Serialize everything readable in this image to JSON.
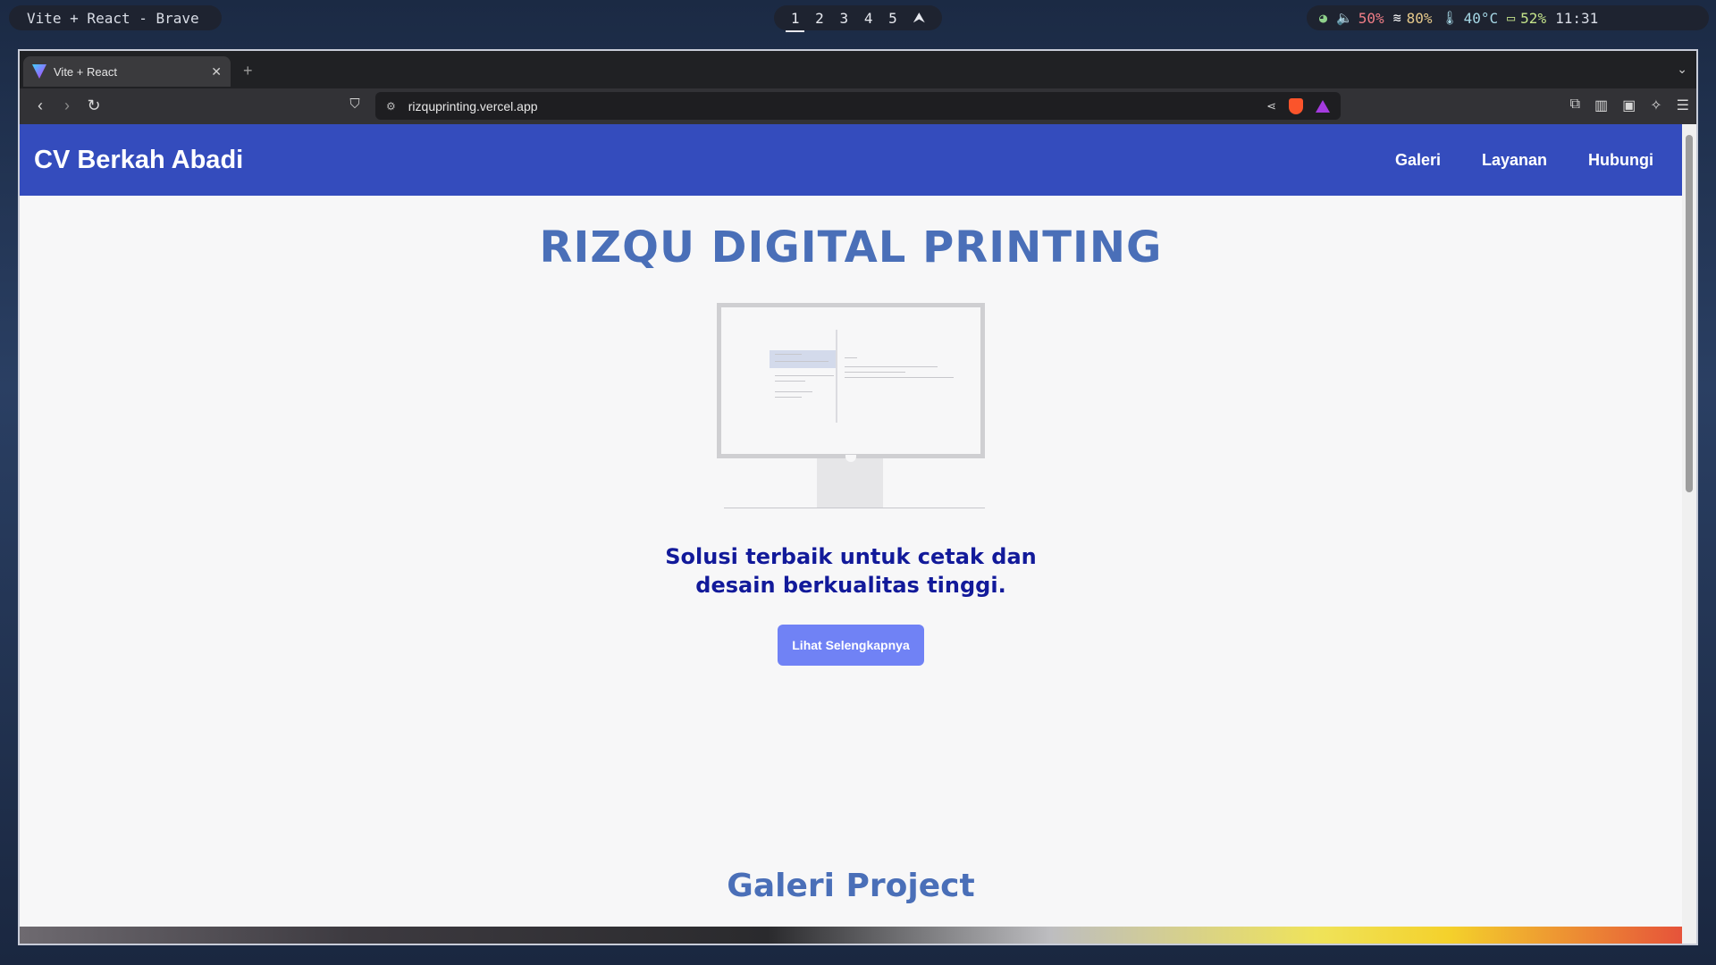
{
  "desktop": {
    "window_title": "Vite + React - Brave",
    "workspaces": [
      "1",
      "2",
      "3",
      "4",
      "5"
    ],
    "workspace_extra_icon": "arch-icon",
    "status": {
      "volume": "50%",
      "wifi": "80%",
      "temperature": "40°C",
      "battery": "52%",
      "clock": "11:31"
    }
  },
  "browser": {
    "tab_title": "Vite + React",
    "url": "rizquprinting.vercel.app"
  },
  "page": {
    "navbar": {
      "brand": "CV Berkah Abadi",
      "links": [
        "Galeri",
        "Layanan",
        "Hubungi"
      ]
    },
    "hero": {
      "title": "RIZQU DIGITAL PRINTING",
      "tagline": "Solusi terbaik untuk cetak dan desain berkualitas tinggi.",
      "cta": "Lihat Selengkapnya"
    },
    "gallery_title": "Galeri Project"
  }
}
